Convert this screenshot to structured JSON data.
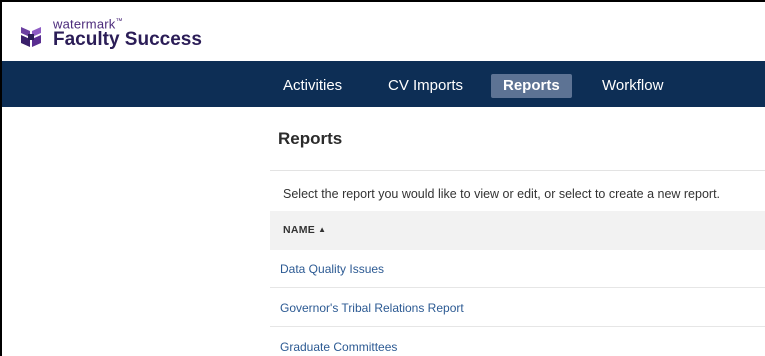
{
  "brand": {
    "small_text": "watermark",
    "trademark": "™",
    "product_name": "Faculty Success",
    "colors": {
      "nav_background": "#0d2e55",
      "nav_active": "#5d7394",
      "link": "#2c5a93",
      "logo_purple": "#4b2a7b"
    }
  },
  "nav": {
    "items": [
      {
        "label": "Activities",
        "active": false
      },
      {
        "label": "CV Imports",
        "active": false
      },
      {
        "label": "Reports",
        "active": true
      },
      {
        "label": "Workflow",
        "active": false
      }
    ]
  },
  "main": {
    "title": "Reports",
    "instructions": "Select the report you would like to view or edit, or select to create a new report.",
    "table": {
      "column_header": "NAME",
      "sort_icon": "▲",
      "rows": [
        {
          "name": "Data Quality Issues"
        },
        {
          "name": "Governor's Tribal Relations Report"
        },
        {
          "name": "Graduate Committees"
        }
      ]
    }
  }
}
